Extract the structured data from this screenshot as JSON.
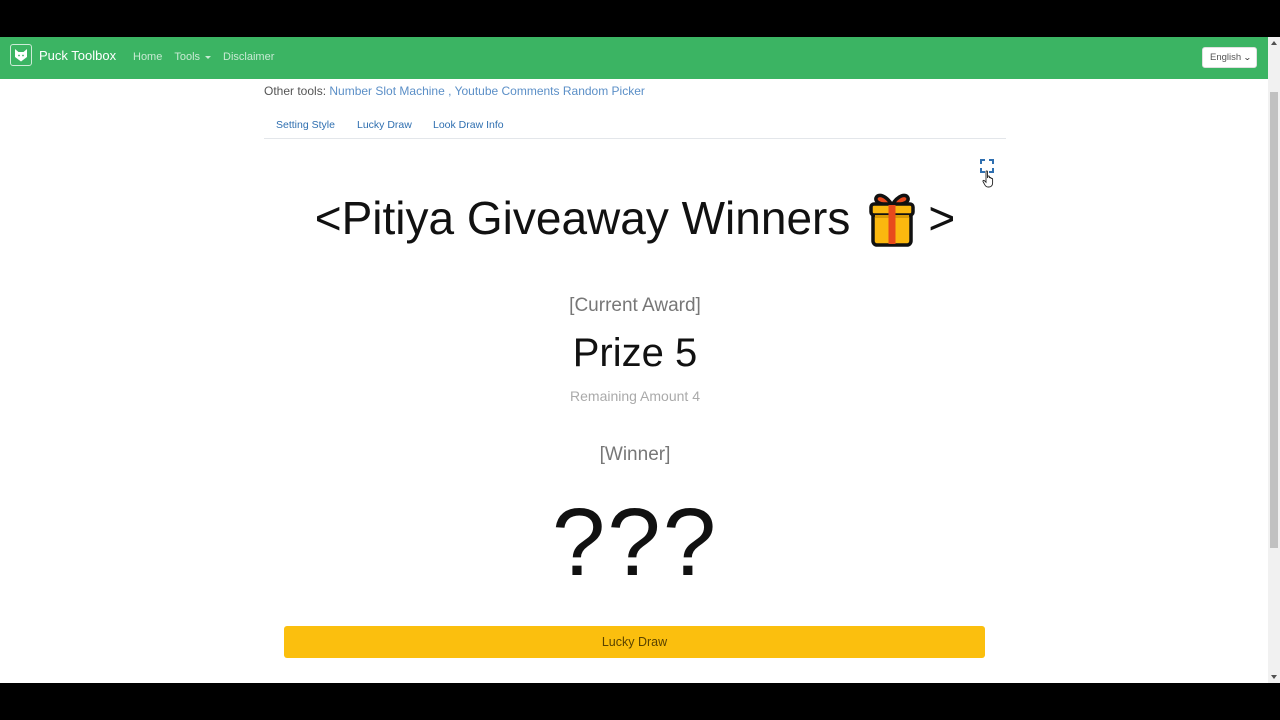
{
  "navbar": {
    "brand": "Puck Toolbox",
    "links": [
      {
        "label": "Home"
      },
      {
        "label": "Tools",
        "has_dropdown": true
      },
      {
        "label": "Disclaimer"
      }
    ],
    "language_select": {
      "selected": "English"
    },
    "background_color": "#3bb463"
  },
  "other_tools": {
    "prefix": "Other tools:",
    "links": [
      "Number Slot Machine",
      "Youtube Comments Random Picker"
    ],
    "separator": " , "
  },
  "tabs": [
    {
      "label": "Setting Style"
    },
    {
      "label": "Lucky Draw"
    },
    {
      "label": "Look Draw Info"
    }
  ],
  "fullscreen_icon": "fullscreen-expand-icon",
  "title": {
    "left": "<Pitiya Giveaway Winners",
    "emoji": "gift-icon",
    "right": ">"
  },
  "award": {
    "label": "[Current Award]",
    "prize": "Prize 5",
    "remaining": "Remaining Amount 4"
  },
  "winner": {
    "label": "[Winner]",
    "value": "???"
  },
  "draw_button": {
    "label": "Lucky Draw",
    "color": "#fbbf0e"
  }
}
